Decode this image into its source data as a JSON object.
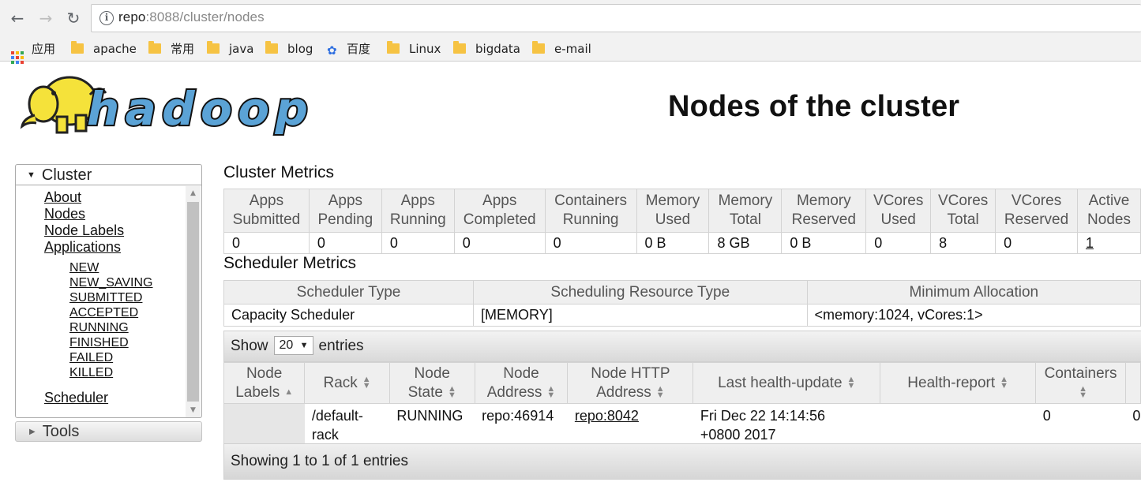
{
  "browser": {
    "url_host": "repo",
    "url_path": ":8088/cluster/nodes",
    "bookmarks": [
      "应用",
      "apache",
      "常用",
      "java",
      "blog",
      "百度",
      "Linux",
      "bigdata",
      "e-mail"
    ]
  },
  "page": {
    "title": "Nodes of the cluster",
    "logo_text": "hadoop"
  },
  "sidebar": {
    "cluster_label": "Cluster",
    "links": [
      "About",
      "Nodes",
      "Node Labels",
      "Applications"
    ],
    "app_states": [
      "NEW",
      "NEW_SAVING",
      "SUBMITTED",
      "ACCEPTED",
      "RUNNING",
      "FINISHED",
      "FAILED",
      "KILLED"
    ],
    "scheduler": "Scheduler",
    "tools_label": "Tools"
  },
  "cluster_metrics": {
    "title": "Cluster Metrics",
    "headers": [
      [
        "Apps",
        "Submitted"
      ],
      [
        "Apps",
        "Pending"
      ],
      [
        "Apps",
        "Running"
      ],
      [
        "Apps",
        "Completed"
      ],
      [
        "Containers",
        "Running"
      ],
      [
        "Memory",
        "Used"
      ],
      [
        "Memory",
        "Total"
      ],
      [
        "Memory",
        "Reserved"
      ],
      [
        "VCores",
        "Used"
      ],
      [
        "VCores",
        "Total"
      ],
      [
        "VCores",
        "Reserved"
      ],
      [
        "Active",
        "Nodes"
      ]
    ],
    "values": [
      "0",
      "0",
      "0",
      "0",
      "0",
      "0 B",
      "8 GB",
      "0 B",
      "0",
      "8",
      "0",
      "1"
    ]
  },
  "scheduler_metrics": {
    "title": "Scheduler Metrics",
    "headers": [
      "Scheduler Type",
      "Scheduling Resource Type",
      "Minimum Allocation"
    ],
    "values": [
      "Capacity Scheduler",
      "[MEMORY]",
      "<memory:1024, vCores:1>"
    ]
  },
  "nodes_table": {
    "show_label": "Show",
    "entries_label": "entries",
    "page_size": "20",
    "headers": [
      [
        "Node",
        "Labels"
      ],
      [
        "Rack"
      ],
      [
        "Node",
        "State"
      ],
      [
        "Node",
        "Address"
      ],
      [
        "Node HTTP",
        "Address"
      ],
      [
        "Last health-update"
      ],
      [
        "Health-report"
      ],
      [
        "Containers"
      ]
    ],
    "rows": [
      {
        "labels": "",
        "rack": [
          "/default-",
          "rack"
        ],
        "state": "RUNNING",
        "address": "repo:46914",
        "http_address": "repo:8042",
        "last_update": [
          "Fri Dec 22 14:14:56",
          "+0800 2017"
        ],
        "health_report": "",
        "containers": "0",
        "next_col": "0"
      }
    ],
    "footer": "Showing 1 to 1 of 1 entries"
  },
  "colors": {
    "logo_blue": "#5ba3d6",
    "logo_yellow": "#f5e23a",
    "header_bg": "#efefef"
  }
}
